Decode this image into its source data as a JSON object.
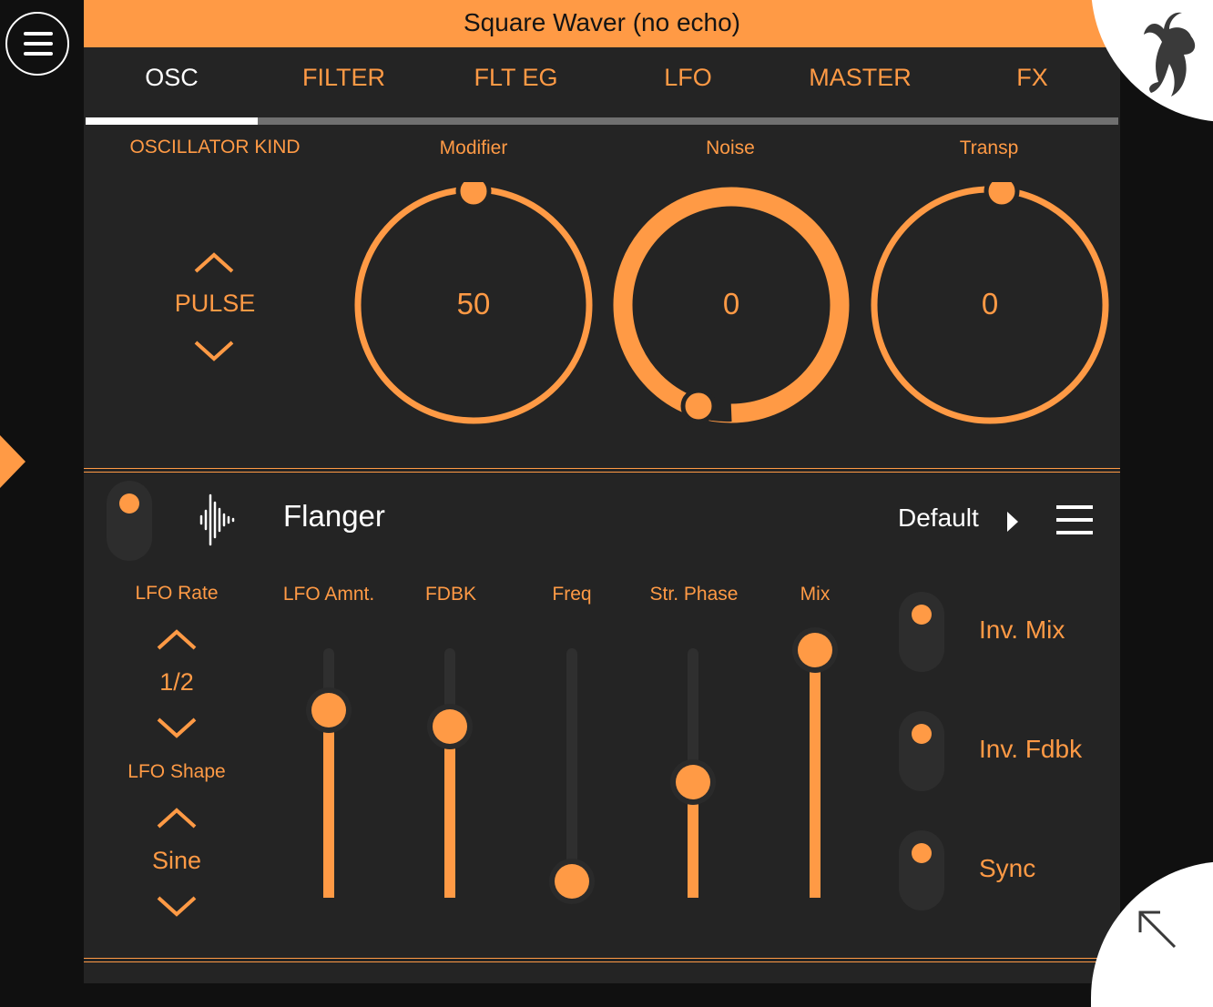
{
  "title": "Square Waver (no echo)",
  "tabs": [
    "OSC",
    "FILTER",
    "FLT EG",
    "LFO",
    "MASTER",
    "FX"
  ],
  "active_tab": "OSC",
  "osc": {
    "kind_label": "OSCILLATOR KIND",
    "kind_value": "PULSE",
    "knobs": [
      {
        "label": "Modifier",
        "value": "50",
        "fill_fraction": 0.0
      },
      {
        "label": "Noise",
        "value": "0",
        "fill_fraction": 0.55
      },
      {
        "label": "Transp",
        "value": "0",
        "fill_fraction": 0.0
      }
    ]
  },
  "fx": {
    "name": "Flanger",
    "preset": "Default",
    "lfo_rate": {
      "label": "LFO Rate",
      "value": "1/2"
    },
    "lfo_shape": {
      "label": "LFO Shape",
      "value": "Sine"
    },
    "sliders": [
      {
        "label": "LFO Amnt.",
        "level": 0.74
      },
      {
        "label": "FDBK",
        "level": 0.67
      },
      {
        "label": "Freq",
        "level": 0.0
      },
      {
        "label": "Str. Phase",
        "level": 0.43
      },
      {
        "label": "Mix",
        "level": 1.0
      }
    ],
    "options": [
      {
        "label": "Inv. Mix"
      },
      {
        "label": "Inv. Fdbk"
      },
      {
        "label": "Sync"
      }
    ]
  },
  "colors": {
    "accent": "#ff9a45",
    "panel": "#242424",
    "background": "#101010",
    "text_light": "#ffffff"
  },
  "icons": [
    "menu-icon",
    "fl-studio-logo-icon",
    "waveform-icon",
    "play-arrow-icon",
    "list-menu-icon",
    "collapse-arrow-icon"
  ]
}
